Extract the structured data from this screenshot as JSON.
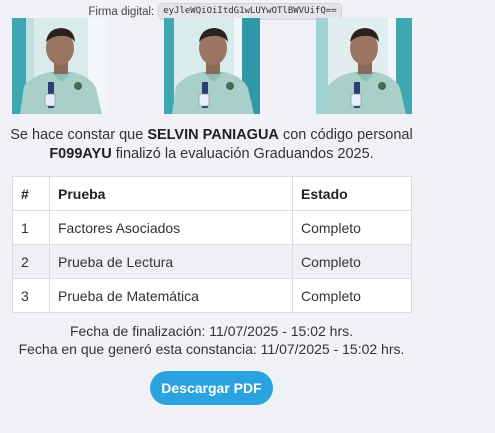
{
  "signature": {
    "label": "Firma digital:",
    "code": "eyJleWQiOiItdG1wLUYwOTlBWVUifQ=="
  },
  "statement": {
    "prefix": "Se hace constar que",
    "name": "SELVIN PANIAGUA",
    "middle": "con código personal",
    "code": "F099AYU",
    "suffix": "finalizó la evaluación Graduandos 2025."
  },
  "table": {
    "headers": [
      "#",
      "Prueba",
      "Estado"
    ],
    "rows": [
      {
        "num": "1",
        "test": "Factores Asociados",
        "status": "Completo"
      },
      {
        "num": "2",
        "test": "Prueba de Lectura",
        "status": "Completo"
      },
      {
        "num": "3",
        "test": "Prueba de Matemática",
        "status": "Completo"
      }
    ]
  },
  "dates": {
    "finish": "Fecha de finalización: 11/07/2025 - 15:02 hrs.",
    "generated": "Fecha en que generó esta constancia: 11/07/2025 - 15:02 hrs."
  },
  "button": {
    "download_label": "Descargar PDF"
  },
  "colors": {
    "accent": "#2aa3e0",
    "background": "#f0f2f8"
  }
}
